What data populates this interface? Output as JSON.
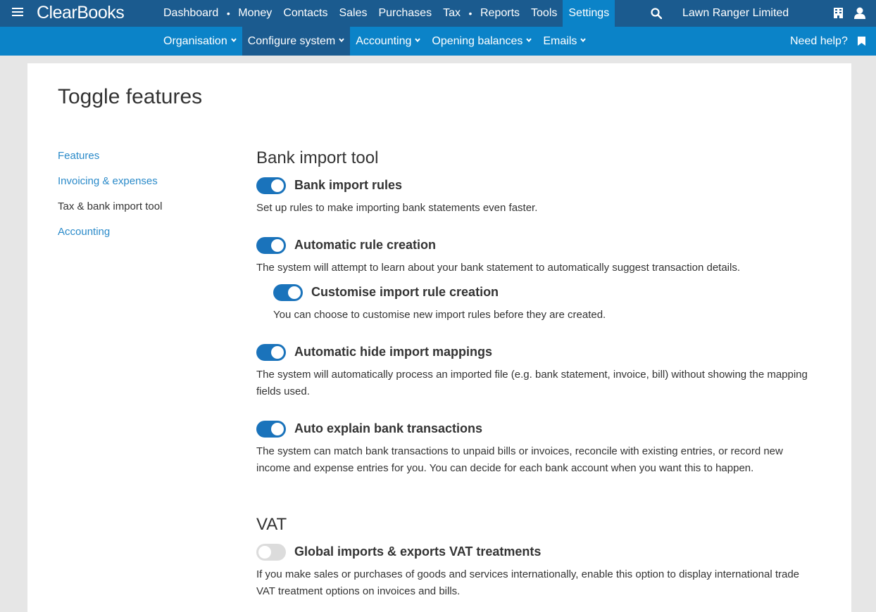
{
  "colors": {
    "topbar": "#1b5b8f",
    "subbar": "#0b83c8",
    "toggle_on": "#1a73bb",
    "toggle_off": "#dcdcdc",
    "link": "#2a8ac9"
  },
  "brand": {
    "logo": "ClearBooks"
  },
  "topnav": {
    "items": [
      "Dashboard",
      "Money",
      "Contacts",
      "Sales",
      "Purchases",
      "Tax",
      "Reports",
      "Tools",
      "Settings"
    ],
    "active": "Settings",
    "company": "Lawn Ranger Limited"
  },
  "subnav": {
    "items": [
      "Organisation",
      "Configure system",
      "Accounting",
      "Opening balances",
      "Emails"
    ],
    "active": "Configure system",
    "help": "Need help?"
  },
  "page": {
    "title": "Toggle features",
    "sidebar": [
      "Features",
      "Invoicing & expenses",
      "Tax & bank import tool",
      "Accounting"
    ],
    "sidebar_current": "Tax & bank import tool"
  },
  "bank_import": {
    "title": "Bank import tool",
    "features": [
      {
        "name": "Bank import rules",
        "desc": "Set up rules to make importing bank statements even faster.",
        "enabled": true
      },
      {
        "name": "Automatic rule creation",
        "desc": "The system will attempt to learn about your bank statement to automatically suggest transaction details.",
        "enabled": true
      },
      {
        "name": "Customise import rule creation",
        "desc": "You can choose to customise new import rules before they are created.",
        "enabled": true
      },
      {
        "name": "Automatic hide import mappings",
        "desc": "The system will automatically process an imported file (e.g. bank statement, invoice, bill) without showing the mapping fields used.",
        "enabled": true
      },
      {
        "name": "Auto explain bank transactions",
        "desc": "The system can match bank transactions to unpaid bills or invoices, reconcile with existing entries, or record new income and expense entries for you. You can decide for each bank account when you want this to happen.",
        "enabled": true
      }
    ]
  },
  "vat": {
    "title": "VAT",
    "features": [
      {
        "name": "Global imports & exports VAT treatments",
        "desc": "If you make sales or purchases of goods and services internationally, enable this option to display international trade VAT treatment options on invoices and bills.",
        "enabled": false
      }
    ]
  }
}
